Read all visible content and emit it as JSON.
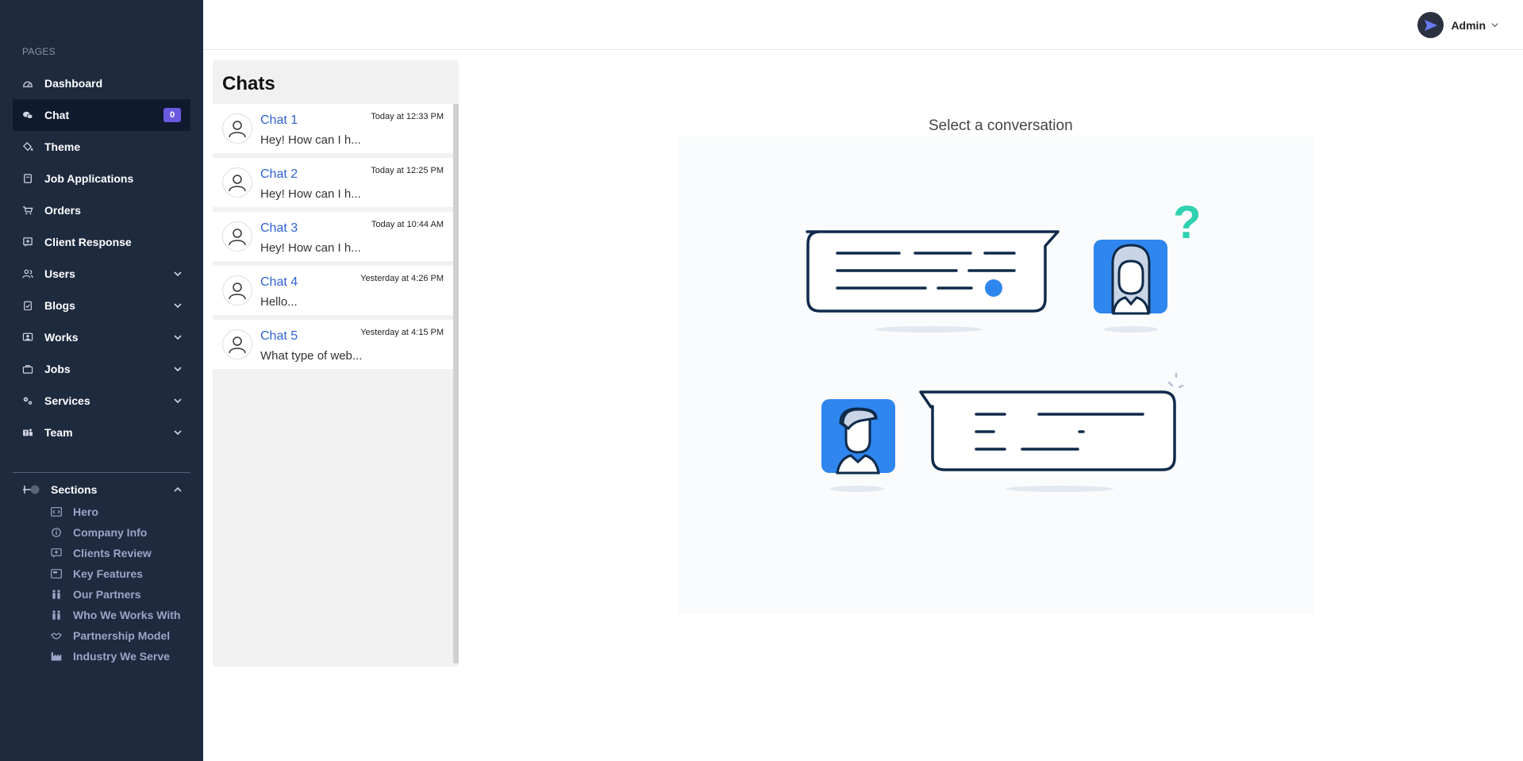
{
  "sidebar": {
    "heading": "PAGES",
    "items": [
      {
        "label": "Dashboard",
        "icon": "dashboard-icon"
      },
      {
        "label": "Chat",
        "icon": "chat-icon",
        "badge": "0"
      },
      {
        "label": "Theme",
        "icon": "paint-bucket-icon"
      },
      {
        "label": "Job Applications",
        "icon": "document-icon"
      },
      {
        "label": "Orders",
        "icon": "cart-icon"
      },
      {
        "label": "Client Response",
        "icon": "message-plus-icon"
      },
      {
        "label": "Users",
        "icon": "users-icon"
      },
      {
        "label": "Blogs",
        "icon": "clipboard-check-icon"
      },
      {
        "label": "Works",
        "icon": "portfolio-icon"
      },
      {
        "label": "Jobs",
        "icon": "briefcase-icon"
      },
      {
        "label": "Services",
        "icon": "gears-icon"
      },
      {
        "label": "Team",
        "icon": "teams-icon"
      }
    ],
    "sections": {
      "label": "Sections",
      "icon": "sections-icon",
      "items": [
        {
          "label": "Hero",
          "icon": "code-icon"
        },
        {
          "label": "Company Info",
          "icon": "info-icon"
        },
        {
          "label": "Clients Review",
          "icon": "review-icon"
        },
        {
          "label": "Key Features",
          "icon": "features-icon"
        },
        {
          "label": "Our Partners",
          "icon": "partners-icon"
        },
        {
          "label": "Who We Works With",
          "icon": "people-icon"
        },
        {
          "label": "Partnership Model",
          "icon": "handshake-icon"
        },
        {
          "label": "Industry We Serve",
          "icon": "industry-icon"
        }
      ]
    }
  },
  "header": {
    "user_name": "Admin"
  },
  "chats": {
    "title": "Chats",
    "items": [
      {
        "name": "Chat 1",
        "preview": "Hey! How can I h...",
        "time": "Today at 12:33 PM"
      },
      {
        "name": "Chat 2",
        "preview": "Hey! How can I h...",
        "time": "Today at 12:25 PM"
      },
      {
        "name": "Chat 3",
        "preview": "Hey! How can I h...",
        "time": "Today at 10:44 AM"
      },
      {
        "name": "Chat 4",
        "preview": "Hello...",
        "time": "Yesterday at 4:26 PM"
      },
      {
        "name": "Chat 5",
        "preview": "What type of web...",
        "time": "Yesterday at 4:15 PM"
      }
    ]
  },
  "main": {
    "title": "Select a conversation"
  },
  "colors": {
    "sidebar_bg": "#1e2a3e",
    "accent": "#6a5ae0",
    "link": "#2f62d6",
    "illustration_blue": "#2f86ee",
    "illustration_green": "#2ed1b0"
  }
}
